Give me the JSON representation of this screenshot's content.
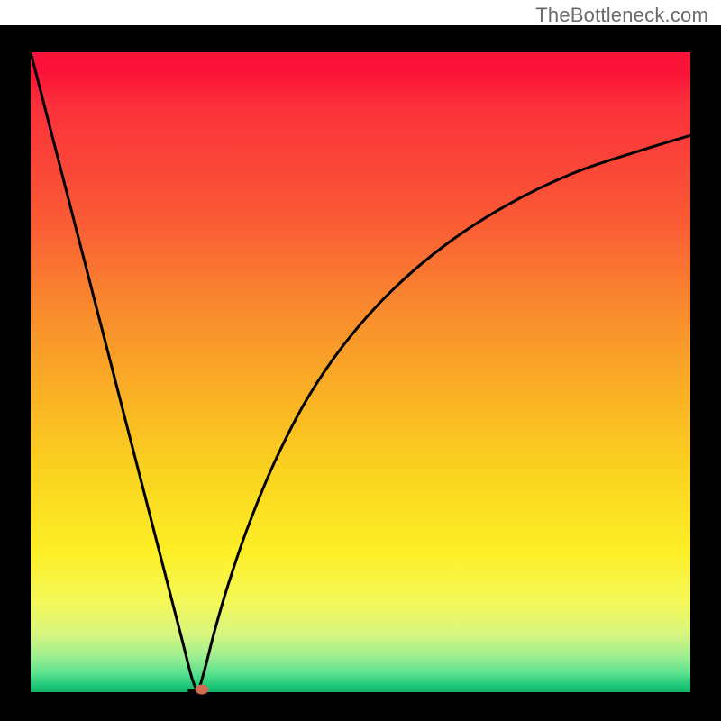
{
  "watermark": "TheBottleneck.com",
  "chart_data": {
    "type": "line",
    "title": "",
    "xlabel": "",
    "ylabel": "",
    "xlim": [
      0,
      100
    ],
    "ylim": [
      0,
      100
    ],
    "background_gradient": {
      "top_color": "#fb1238",
      "bottom_color": "#16b36a",
      "meaning": "vertical gradient from red (top) through orange, yellow to green (bottom)"
    },
    "series": [
      {
        "name": "left-branch",
        "x": [
          0,
          3,
          6,
          9,
          12,
          15,
          18,
          21,
          23,
          24.5,
          25.4
        ],
        "values": [
          100,
          88,
          76,
          64,
          52,
          40,
          28,
          16,
          8,
          2,
          0
        ]
      },
      {
        "name": "right-branch",
        "x": [
          25.4,
          26.5,
          28,
          30,
          33,
          37,
          42,
          48,
          55,
          63,
          72,
          82,
          92,
          100
        ],
        "values": [
          0,
          4,
          10,
          17,
          26,
          36,
          46,
          55,
          63,
          70,
          76,
          81,
          84.5,
          87
        ]
      }
    ],
    "marker": {
      "name": "bottleneck-point",
      "x": 26.0,
      "y": 0.3,
      "color": "#d26b54"
    }
  }
}
